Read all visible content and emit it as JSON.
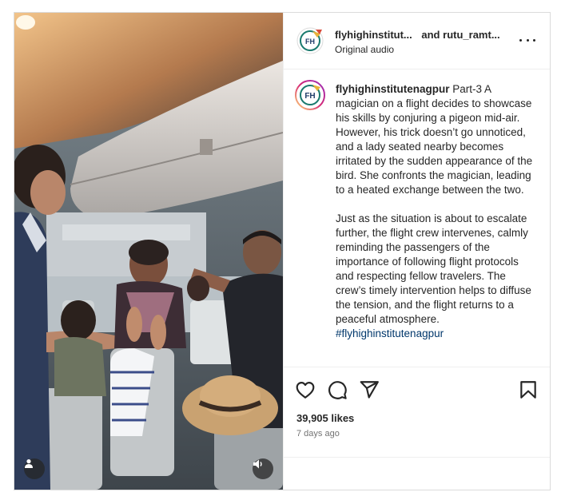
{
  "header": {
    "username": "flyhighinstitut...",
    "conjunction": "and",
    "collaborator": "rutu_ramt...",
    "audio": "Original audio"
  },
  "caption": {
    "username": "flyhighinstitutenagpur",
    "title": "Part-3",
    "paragraph1": "A magician on a flight decides to showcase his skills by conjuring a pigeon mid-air. However, his trick doesn’t go unnoticed, and a lady seated nearby becomes irritated by the sudden appearance of the bird. She confronts the magician, leading to a heated exchange between the two.",
    "paragraph2": "Just as the situation is about to escalate further, the flight crew intervenes, calmly reminding the passengers of the importance of following flight protocols and respecting fellow travelers. The crew’s timely intervention helps to diffuse the tension, and the flight returns to a peaceful atmosphere.",
    "hashtag": "#flyhighinstitutenagpur"
  },
  "avatar": {
    "initials": "FH"
  },
  "stats": {
    "likes": "39,905 likes",
    "posted": "7 days ago"
  },
  "icons": {
    "more": "more-options-icon",
    "like": "heart-icon",
    "comment": "comment-icon",
    "share": "paper-plane-icon",
    "save": "bookmark-icon",
    "user_tag": "user-tag-icon",
    "volume": "volume-icon"
  },
  "colors": {
    "text": "#262626",
    "muted": "#737373",
    "link": "#00376b",
    "border": "#dbdbdb",
    "avatar_ring": "#e1306c"
  }
}
